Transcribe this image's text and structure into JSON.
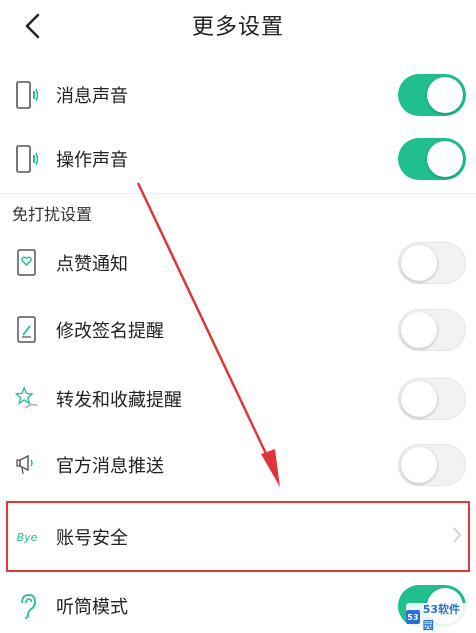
{
  "header": {
    "title": "更多设置"
  },
  "sound_settings": [
    {
      "id": "msg-sound",
      "label": "消息声音",
      "toggle": "on",
      "icon": "phone-sound-icon"
    },
    {
      "id": "op-sound",
      "label": "操作声音",
      "toggle": "on",
      "icon": "phone-sound-icon"
    }
  ],
  "dnd_section": {
    "title": "免打扰设置"
  },
  "dnd_settings": [
    {
      "id": "like-notify",
      "label": "点赞通知",
      "toggle": "off",
      "icon": "heart-card-icon"
    },
    {
      "id": "sign-remind",
      "label": "修改签名提醒",
      "toggle": "off",
      "icon": "pen-card-icon"
    },
    {
      "id": "forward-remind",
      "label": "转发和收藏提醒",
      "toggle": "off",
      "icon": "star-share-icon"
    },
    {
      "id": "official-push",
      "label": "官方消息推送",
      "toggle": "off",
      "icon": "megaphone-icon"
    }
  ],
  "account_security": {
    "label": "账号安全",
    "icon_text": "Bye"
  },
  "earpiece_mode": {
    "label": "听筒模式",
    "toggle": "on",
    "icon": "ear-icon"
  },
  "watermark": {
    "text": "53软件园",
    "logo_text": "53"
  },
  "colors": {
    "accent": "#1fbf8f",
    "highlight": "#e23a3a",
    "arrow": "#e0363a"
  }
}
